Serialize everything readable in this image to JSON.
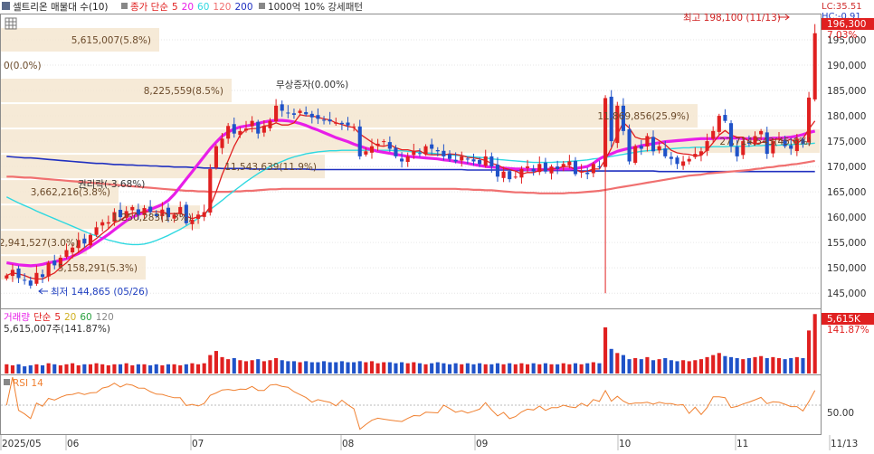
{
  "header": {
    "title": "셀트리온 매물대 수(10)",
    "price_legend": [
      "종가 단순",
      "5",
      "20",
      "60",
      "120",
      "200"
    ],
    "volume_band_legend": "1000억 10% 강세패턴",
    "lc": "LC:35.51",
    "hc": "HC:-0.91"
  },
  "colors": {
    "up": "#e02020",
    "down": "#1f52c8",
    "ma5": "#e02020",
    "ma20": "#e81ee8",
    "ma60": "#2ed8e0",
    "ma120": "#f07070",
    "ma200": "#2030c0",
    "volume_band": "#f5e6d0",
    "rsi": "#f08030"
  },
  "price_panel": {
    "high_label": "최고 198,100 (11/13)",
    "low_label": "최저 144,865 (05/26)",
    "current_price": "196,300",
    "current_change": "7.03%",
    "events": [
      "무상증자(0.00%)",
      "권리락(-3.68%)"
    ],
    "volume_bands": [
      {
        "label": "5,615,007(5.8%)",
        "price": 195000
      },
      {
        "label": "0(0.0%)",
        "price": 190000
      },
      {
        "label": "8,225,559(8.5%)",
        "price": 185000
      },
      {
        "label": "11,869,856(25.9%)",
        "price": 180000
      },
      {
        "label": "27,714,543(45.6%)",
        "price": 175000
      },
      {
        "label": "11,543,639(11.9%)",
        "price": 170000
      },
      {
        "label": "3,662,216(3.8%)",
        "price": 165000
      },
      {
        "label": "1,250,283(1.3%)",
        "price": 160000
      },
      {
        "label": "2,941,527(3.0%)",
        "price": 155000
      },
      {
        "label": "5,158,291(5.3%)",
        "price": 150000
      }
    ]
  },
  "volume_panel": {
    "legend": [
      "거래량",
      "단순",
      "5",
      "20",
      "60",
      "120"
    ],
    "summary": "5,615,007주(141.87%)",
    "current_value": "5,615K",
    "current_ratio": "141.87%"
  },
  "rsi_panel": {
    "legend": "RSI 14",
    "reference": "50.00"
  },
  "x_axis": {
    "labels": [
      "2025/05",
      "06",
      "07",
      "08",
      "09",
      "10",
      "11",
      "11/13"
    ]
  },
  "chart_data": {
    "type": "candlestick",
    "y_axis": {
      "range": [
        142000,
        200000
      ],
      "ticks": [
        145000,
        150000,
        155000,
        160000,
        165000,
        170000,
        175000,
        180000,
        185000,
        190000,
        195000
      ],
      "tick_labels": [
        "145,000",
        "150,000",
        "155,000",
        "160,000",
        "165,000",
        "170,000",
        "175,000",
        "180,000",
        "185,000",
        "190,000",
        "195,000"
      ]
    },
    "close": [
      148500,
      149600,
      148000,
      147500,
      146500,
      149000,
      148200,
      151000,
      150500,
      152000,
      153500,
      154000,
      155500,
      154800,
      156500,
      158000,
      159000,
      159000,
      161000,
      160000,
      161200,
      162000,
      160500,
      161800,
      161000,
      160200,
      161500,
      160000,
      160500,
      162000,
      158800,
      159500,
      160500,
      161000,
      169500,
      174000,
      175500,
      178000,
      176500,
      177000,
      177500,
      179000,
      176500,
      178000,
      179000,
      182000,
      181000,
      180500,
      180200,
      181000,
      180300,
      179700,
      179400,
      179100,
      178900,
      178700,
      178400,
      178100,
      177900,
      172000,
      173000,
      174000,
      174500,
      175000,
      173500,
      172000,
      171000,
      172000,
      173000,
      172500,
      174000,
      173500,
      173000,
      172000,
      171500,
      171000,
      172000,
      171500,
      171000,
      170500,
      172000,
      170000,
      168000,
      169000,
      167500,
      168000,
      169500,
      170000,
      169000,
      170500,
      169000,
      170000,
      169500,
      170500,
      171000,
      168500,
      169000,
      168500,
      170500,
      170000,
      183500,
      175000,
      182000,
      177000,
      171000,
      174000,
      173500,
      176000,
      173000,
      174000,
      172000,
      171500,
      170500,
      171000,
      171500,
      172500,
      173000,
      175000,
      177000,
      180000,
      179000,
      174000,
      172000,
      175000,
      174500,
      176000,
      177000,
      172500,
      175000,
      175500,
      174000,
      173500,
      175500,
      174500,
      183600,
      196300
    ],
    "ma": {
      "ma5": [
        148500,
        149000,
        148800,
        148500,
        148000,
        147800,
        147800,
        148400,
        149000,
        150100,
        151000,
        152200,
        153100,
        154000,
        154900,
        155800,
        156800,
        157700,
        158900,
        159400,
        160300,
        160800,
        160900,
        161100,
        161100,
        161100,
        161000,
        160700,
        160700,
        160800,
        160200,
        159700,
        160100,
        160400,
        162100,
        165000,
        168400,
        171200,
        174000,
        176200,
        177300,
        177500,
        177500,
        178000,
        178100,
        178600,
        178200,
        178200,
        178600,
        180200,
        180000,
        180000,
        179700,
        179400,
        179200,
        178600,
        178300,
        177900,
        177700,
        176400,
        175600,
        174800,
        174100,
        174000,
        174300,
        173700,
        173300,
        173300,
        173000,
        173100,
        172400,
        172300,
        172300,
        172300,
        172500,
        172400,
        172200,
        171800,
        171700,
        171500,
        171200,
        170600,
        170300,
        169700,
        169400,
        169100,
        168500,
        168800,
        168800,
        169200,
        169400,
        169500,
        169600,
        170000,
        170000,
        169400,
        168900,
        169100,
        169500,
        169500,
        171400,
        173600,
        176300,
        178700,
        177600,
        175800,
        175400,
        175400,
        175800,
        175100,
        174300,
        173200,
        172700,
        172500,
        172400,
        172100,
        172200,
        173300,
        174700,
        176200,
        177100,
        176200,
        175800,
        175800,
        175000,
        174400,
        174700,
        175100,
        175300,
        175400,
        174900,
        175400,
        174500,
        175500,
        177400,
        179000
      ],
      "ma20": [
        151000,
        150800,
        150600,
        150500,
        150400,
        150500,
        150700,
        151000,
        151200,
        151500,
        151800,
        152300,
        152800,
        153500,
        154200,
        155000,
        155800,
        156600,
        157500,
        158400,
        159300,
        160000,
        160500,
        161000,
        161500,
        162000,
        162500,
        163300,
        164500,
        166000,
        167500,
        169000,
        170500,
        172000,
        173500,
        174800,
        176000,
        176800,
        177400,
        177800,
        178000,
        178200,
        178500,
        178800,
        179000,
        179100,
        179100,
        179000,
        178800,
        178500,
        178100,
        177600,
        177200,
        176700,
        176200,
        175700,
        175300,
        174900,
        174400,
        174000,
        173600,
        173300,
        173000,
        172800,
        172600,
        172400,
        172200,
        172000,
        171900,
        171800,
        171700,
        171600,
        171500,
        171300,
        171200,
        171000,
        170800,
        170600,
        170400,
        170200,
        170000,
        169900,
        169800,
        169700,
        169600,
        169500,
        169500,
        169400,
        169400,
        169400,
        169400,
        169500,
        169500,
        169500,
        169500,
        169600,
        169800,
        170000,
        170600,
        171500,
        172100,
        172500,
        173000,
        173300,
        173600,
        173800,
        174100,
        174300,
        174500,
        174700,
        174900,
        175000,
        175100,
        175200,
        175300,
        175400,
        175500,
        175500,
        175500,
        175600,
        175600,
        175600,
        175600,
        175500,
        175500,
        175500,
        175500,
        175500,
        175600,
        175600,
        175700,
        175800,
        176000,
        176300,
        176700,
        177000
      ],
      "ma60": [
        164000,
        163400,
        162800,
        162300,
        161800,
        161200,
        160700,
        160200,
        159700,
        159200,
        158700,
        158200,
        157700,
        157200,
        156700,
        156300,
        155900,
        155500,
        155200,
        154900,
        154700,
        154600,
        154600,
        154700,
        155000,
        155400,
        155900,
        156400,
        157000,
        157600,
        158300,
        159000,
        159800,
        160600,
        161500,
        162400,
        163300,
        164300,
        165200,
        166100,
        167000,
        167800,
        168600,
        169300,
        170000,
        170500,
        171000,
        171500,
        171900,
        172200,
        172500,
        172700,
        172900,
        173000,
        173100,
        173100,
        173200,
        173200,
        173200,
        173200,
        173200,
        173200,
        173200,
        173200,
        173200,
        173100,
        173100,
        173000,
        172900,
        172800,
        172700,
        172600,
        172500,
        172400,
        172300,
        172200,
        172100,
        172000,
        171900,
        171800,
        171700,
        171500,
        171400,
        171300,
        171200,
        171100,
        171000,
        170900,
        170800,
        170800,
        170800,
        170800,
        170900,
        170900,
        171000,
        171100,
        171200,
        171300,
        171500,
        171600,
        171800,
        172000,
        172200,
        172400,
        172600,
        172800,
        173000,
        173100,
        173200,
        173300,
        173400,
        173500,
        173600,
        173700,
        173700,
        173800,
        173800,
        173800,
        173900,
        173900,
        173900,
        174000,
        174000,
        174000,
        174000,
        174100,
        174100,
        174200,
        174200,
        174200,
        174300,
        174300,
        174400,
        174400,
        174500,
        174600
      ],
      "ma120": [
        168000,
        168000,
        167900,
        167800,
        167800,
        167700,
        167600,
        167500,
        167400,
        167300,
        167200,
        167100,
        167000,
        166900,
        166800,
        166700,
        166600,
        166500,
        166400,
        166300,
        166200,
        166100,
        166000,
        165900,
        165800,
        165700,
        165600,
        165500,
        165400,
        165300,
        165200,
        165200,
        165100,
        165100,
        165000,
        165000,
        165000,
        165000,
        165100,
        165100,
        165200,
        165200,
        165300,
        165400,
        165500,
        165500,
        165600,
        165600,
        165600,
        165600,
        165600,
        165600,
        165600,
        165600,
        165600,
        165600,
        165600,
        165600,
        165600,
        165600,
        165600,
        165600,
        165600,
        165600,
        165600,
        165600,
        165600,
        165600,
        165600,
        165600,
        165600,
        165600,
        165600,
        165600,
        165600,
        165600,
        165500,
        165500,
        165400,
        165400,
        165300,
        165300,
        165200,
        165100,
        165000,
        164900,
        164900,
        164800,
        164800,
        164700,
        164700,
        164700,
        164700,
        164700,
        164800,
        164800,
        164900,
        165000,
        165100,
        165200,
        165400,
        165600,
        165800,
        166000,
        166200,
        166400,
        166600,
        166800,
        167000,
        167200,
        167400,
        167600,
        167800,
        168000,
        168200,
        168300,
        168400,
        168600,
        168700,
        168800,
        168900,
        169000,
        169100,
        169200,
        169300,
        169500,
        169600,
        169800,
        169900,
        170100,
        170200,
        170400,
        170500,
        170700,
        170900,
        171100
      ],
      "ma200": [
        172000,
        171900,
        171800,
        171700,
        171700,
        171600,
        171500,
        171400,
        171300,
        171200,
        171100,
        171000,
        170900,
        170800,
        170700,
        170600,
        170600,
        170500,
        170400,
        170400,
        170300,
        170300,
        170200,
        170200,
        170100,
        170100,
        170000,
        170000,
        169900,
        169900,
        169900,
        169800,
        169800,
        169700,
        169700,
        169700,
        169600,
        169600,
        169600,
        169600,
        169600,
        169500,
        169500,
        169500,
        169500,
        169500,
        169500,
        169500,
        169500,
        169500,
        169500,
        169400,
        169400,
        169400,
        169400,
        169400,
        169400,
        169400,
        169400,
        169400,
        169400,
        169400,
        169400,
        169400,
        169400,
        169400,
        169400,
        169400,
        169400,
        169400,
        169400,
        169400,
        169400,
        169400,
        169400,
        169400,
        169400,
        169300,
        169300,
        169300,
        169300,
        169300,
        169300,
        169300,
        169300,
        169200,
        169200,
        169200,
        169200,
        169200,
        169200,
        169200,
        169200,
        169200,
        169200,
        169200,
        169100,
        169100,
        169100,
        169100,
        169100,
        169100,
        169100,
        169100,
        169100,
        169100,
        169100,
        169100,
        169100,
        169000,
        169000,
        169000,
        169000,
        169000,
        169000,
        169000,
        169000,
        169000,
        169000,
        169000,
        169000,
        169000,
        169000,
        169000,
        169000,
        169000,
        169000,
        169000,
        169000,
        169000,
        169000,
        169000,
        169000,
        169000,
        169000,
        169000
      ]
    },
    "special_wicks": {
      "low_day_index": 100,
      "low_value": 145000,
      "high_day_index": 135,
      "high_value": 198100
    }
  }
}
